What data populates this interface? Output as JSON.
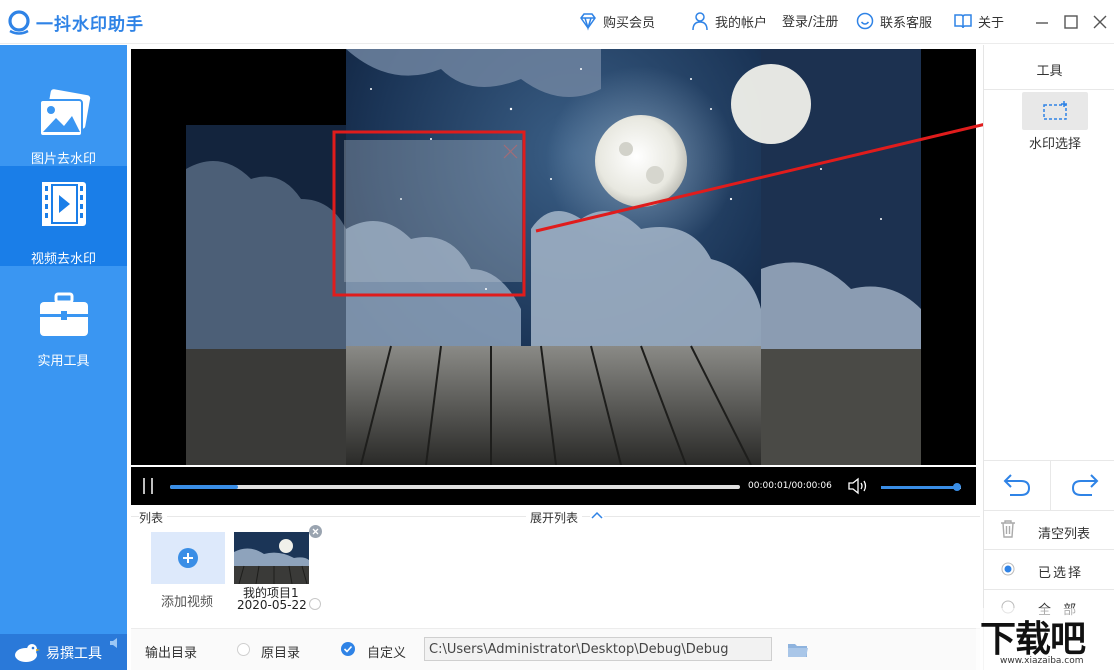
{
  "app": {
    "title": "一抖水印助手"
  },
  "header": {
    "buy_vip": "购买会员",
    "my_account": "我的帐户",
    "login": "登录/注册",
    "support": "联系客服",
    "about": "关于"
  },
  "sidebar": {
    "items": [
      {
        "label": "图片去水印",
        "icon": "image-icon",
        "active": false
      },
      {
        "label": "视频去水印",
        "icon": "film-icon",
        "active": true
      },
      {
        "label": "实用工具",
        "icon": "toolbox-icon",
        "active": false
      }
    ],
    "promo": "易撰工具"
  },
  "tools": {
    "title": "工具",
    "watermark_select": "水印选择",
    "clear_list": "清空列表",
    "selected": "已选择",
    "all": "全 部"
  },
  "player": {
    "time": "00:00:01/00:00:06",
    "progress": 0.12,
    "volume": 0.95
  },
  "list": {
    "title": "列表",
    "expand": "展开列表",
    "add_video": "添加视频",
    "items": [
      {
        "name": "我的项目1",
        "date": "2020-05-22"
      }
    ]
  },
  "output": {
    "label": "输出目录",
    "original": "原目录",
    "custom": "自定义",
    "path": "C:\\Users\\Administrator\\Desktop\\Debug\\Debug"
  },
  "site_watermark": {
    "text": "下载吧",
    "url": "www.xiazaiba.com"
  },
  "colors": {
    "brand": "#3a96f2",
    "brand_dark": "#1a7ee8",
    "highlight": "#e01c1c"
  }
}
